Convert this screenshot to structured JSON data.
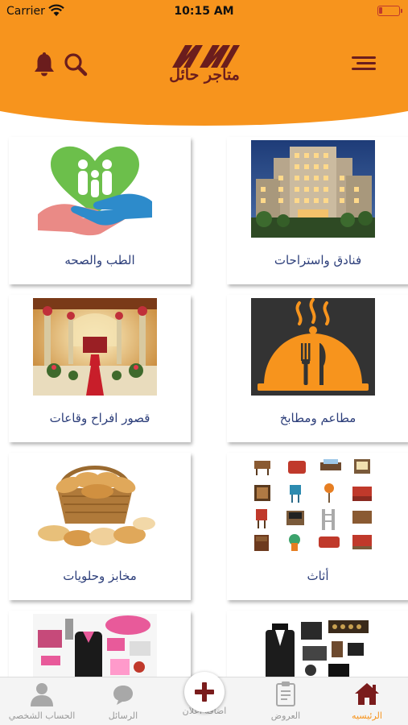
{
  "status_bar": {
    "carrier": "Carrier",
    "time": "10:15 AM"
  },
  "header": {
    "logo_text": "متاجر حائل",
    "logo_letters": "MH"
  },
  "categories": [
    {
      "label": "فنادق واستراحات",
      "image": "hotel-building-photo"
    },
    {
      "label": "الطب والصحه",
      "image": "heart-hands-family-logo"
    },
    {
      "label": "مطاعم ومطابخ",
      "image": "cloche-fork-knife-icon"
    },
    {
      "label": "قصور افراح وقاعات",
      "image": "wedding-hall-photo"
    },
    {
      "label": "أثاث",
      "image": "furniture-icons-grid"
    },
    {
      "label": "مخابز وحلويات",
      "image": "bread-basket-photo"
    },
    {
      "label": "",
      "image": "mens-suit-accessories-photo"
    },
    {
      "label": "",
      "image": "womens-fashion-accessories-photo"
    }
  ],
  "bottom_nav": {
    "home": "الرئيسيه",
    "offers": "العروض",
    "add_ad": "اضافة اعلان",
    "messages": "الرسائل",
    "profile": "الحساب الشخصي"
  },
  "colors": {
    "accent": "#f7941d",
    "brand_dark": "#6b1d1d",
    "label_blue": "#2c3e7a",
    "battery_red": "#c0392b"
  }
}
